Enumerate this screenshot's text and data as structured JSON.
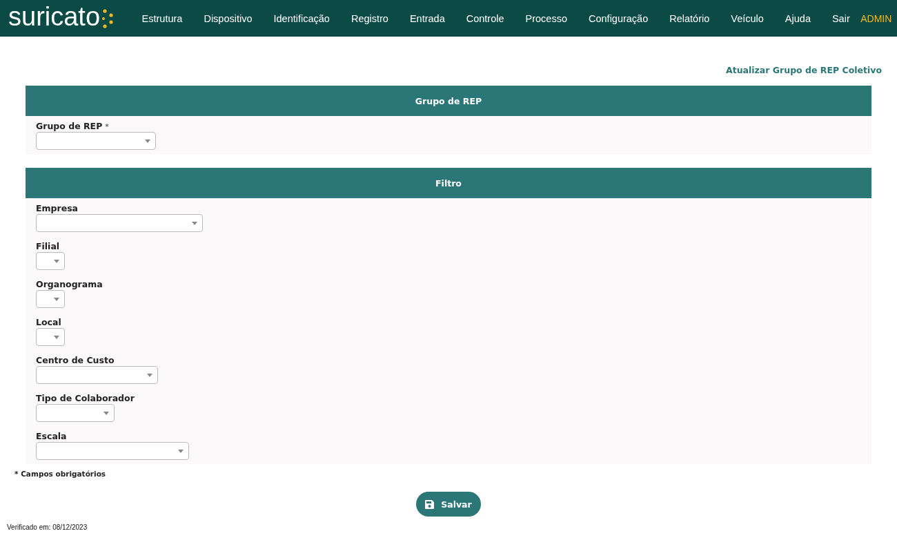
{
  "brand": {
    "name": "suricato"
  },
  "nav": [
    "Estrutura",
    "Dispositivo",
    "Identificação",
    "Registro",
    "Entrada",
    "Controle",
    "Processo",
    "Configuração",
    "Relatório",
    "Veículo",
    "Ajuda",
    "Sair"
  ],
  "user": "ADMIN",
  "page_title": "Atualizar Grupo de REP Coletivo",
  "sections": [
    {
      "title": "Grupo de REP",
      "fields": [
        {
          "label": "Grupo de REP",
          "required_mark": "*"
        }
      ]
    },
    {
      "title": "Filtro",
      "fields": [
        {
          "label": "Empresa"
        },
        {
          "label": "Filial"
        },
        {
          "label": "Organograma"
        },
        {
          "label": "Local"
        },
        {
          "label": "Centro de Custo"
        },
        {
          "label": "Tipo de Colaborador"
        },
        {
          "label": "Escala"
        }
      ]
    }
  ],
  "required_note": "* Campos obrigatórios",
  "save_button": "Salvar",
  "footer": "Verificado em: 08/12/2023"
}
